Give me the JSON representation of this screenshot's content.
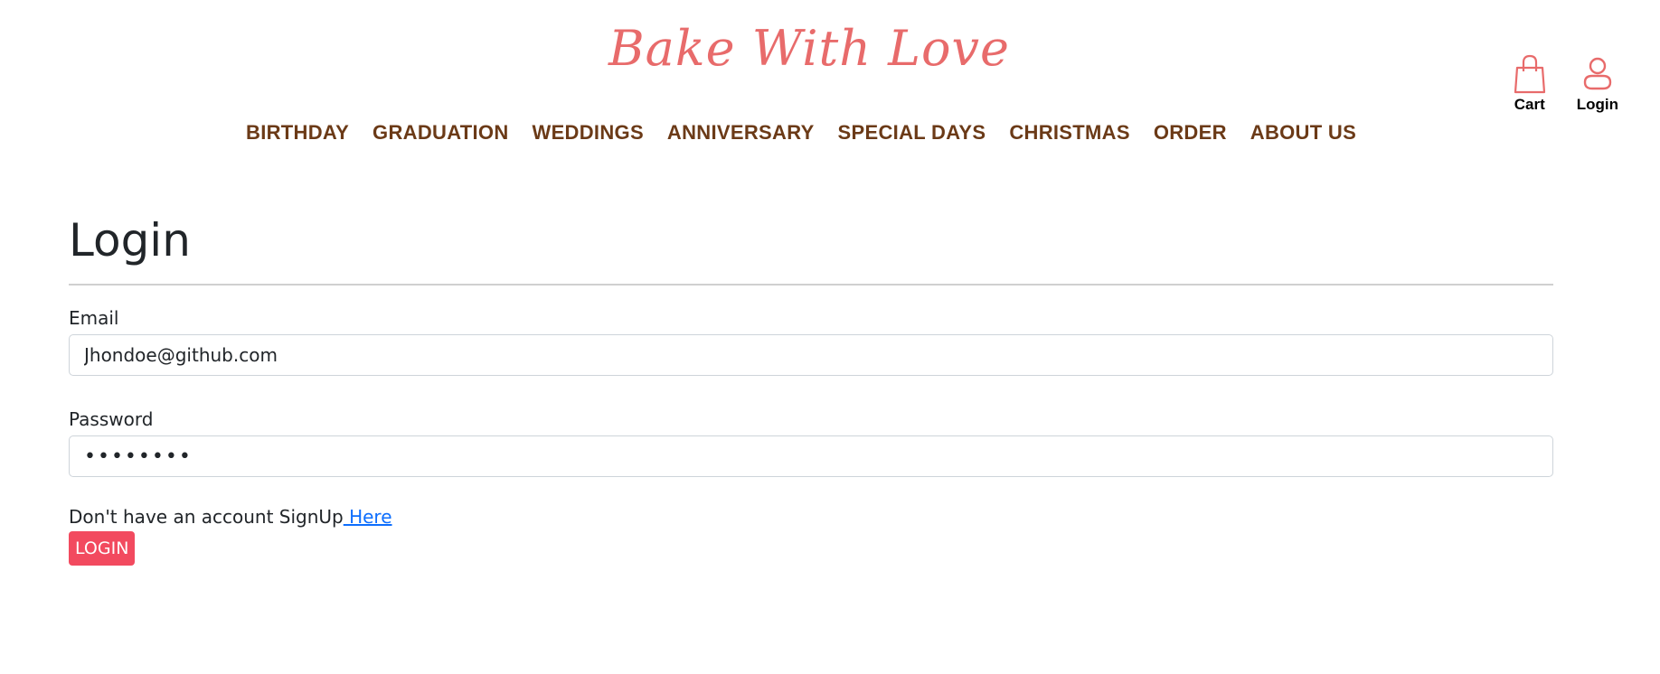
{
  "brand": {
    "title": "Bake With Love"
  },
  "nav": {
    "items": [
      {
        "label": "BIRTHDAY"
      },
      {
        "label": "GRADUATION"
      },
      {
        "label": "WEDDINGS"
      },
      {
        "label": "ANNIVERSARY"
      },
      {
        "label": "SPECIAL DAYS"
      },
      {
        "label": "CHRISTMAS"
      },
      {
        "label": "ORDER"
      },
      {
        "label": "ABOUT US"
      }
    ]
  },
  "header_icons": {
    "cart": {
      "label": "Cart",
      "icon": "shopping-bag-icon"
    },
    "login": {
      "label": "Login",
      "icon": "user-icon"
    }
  },
  "colors": {
    "brand": "#e86b6b",
    "nav_text": "#6b3a17",
    "button": "#f24a5f",
    "link": "#0d6efd"
  },
  "form": {
    "title": "Login",
    "email_label": "Email",
    "email_value": "Jhondoe@github.com",
    "password_label": "Password",
    "password_value": "••••••••",
    "signup_text": "Don't have an account SignUp",
    "signup_link": " Here",
    "submit_label": "LOGIN"
  }
}
